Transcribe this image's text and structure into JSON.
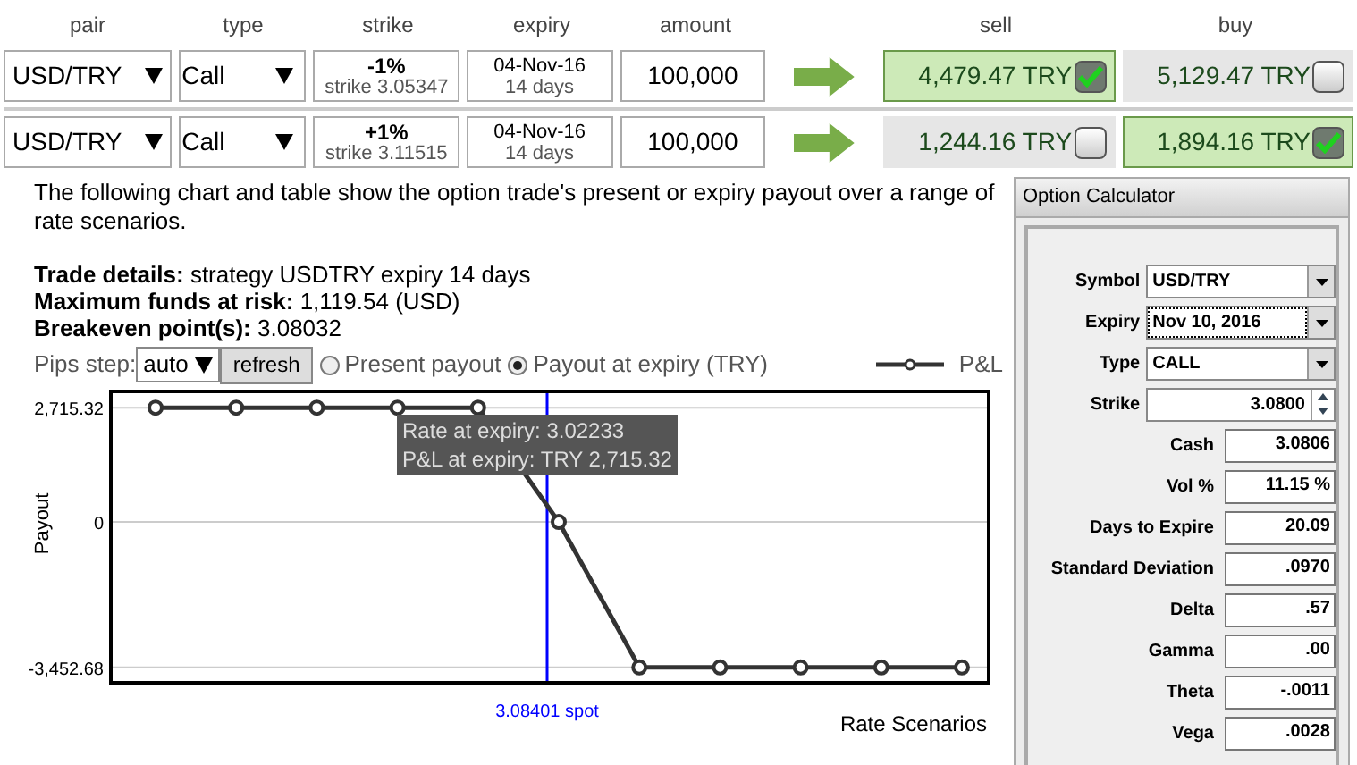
{
  "trades": {
    "columns": [
      "pair",
      "type",
      "strike",
      "expiry",
      "amount",
      "sell",
      "buy"
    ],
    "rows": [
      {
        "pair": "USD/TRY",
        "type": "Call",
        "strike_pct": "-1%",
        "strike": "strike 3.05347",
        "expiry_date": "04-Nov-16",
        "expiry_days": "14 days",
        "amount": "100,000",
        "sell": {
          "value": "4,479.47 TRY",
          "selected": true
        },
        "buy": {
          "value": "5,129.47 TRY",
          "selected": false
        }
      },
      {
        "pair": "USD/TRY",
        "type": "Call",
        "strike_pct": "+1%",
        "strike": "strike 3.11515",
        "expiry_date": "04-Nov-16",
        "expiry_days": "14 days",
        "amount": "100,000",
        "sell": {
          "value": "1,244.16 TRY",
          "selected": false
        },
        "buy": {
          "value": "1,894.16 TRY",
          "selected": true
        }
      }
    ]
  },
  "description": "The following chart and table show the option trade's present or expiry payout over a range of rate scenarios.",
  "details": [
    {
      "label": "Trade details:",
      "value": "strategy USDTRY expiry 14 days"
    },
    {
      "label": "Maximum funds at risk:",
      "value": "1,119.54 (USD)"
    },
    {
      "label": "Breakeven point(s):",
      "value": "3.08032"
    }
  ],
  "pips": {
    "label": "Pips step:",
    "value": "auto",
    "button": "refresh"
  },
  "payout_options": [
    {
      "label": "Present payout",
      "selected": false
    },
    {
      "label": "Payout at expiry (TRY)",
      "selected": true
    }
  ],
  "chart": {
    "chart_data": {
      "type": "line",
      "xlabel": "Rate Scenarios",
      "ylabel": "Payout",
      "series": [
        {
          "name": "P&L",
          "color": "#333333",
          "values": [
            2715.32,
            2715.32,
            2715.32,
            2715.32,
            2715.32,
            0,
            -3452.68,
            -3452.68,
            -3452.68,
            -3452.68,
            -3452.68
          ]
        }
      ],
      "ylim": [
        -3860,
        3100
      ],
      "grid": true,
      "marker": "circle",
      "yticks": [
        {
          "value": 2715.32,
          "label": "2,715.32"
        },
        {
          "value": 0,
          "label": "0"
        },
        {
          "value": -3452.68,
          "label": "-3,452.68"
        }
      ],
      "annotations": [
        "3.08401 spot"
      ]
    },
    "tooltip": [
      "Rate at expiry: 3.02233",
      "P&L at expiry: TRY 2,715.32"
    ]
  },
  "calculator": {
    "title": "Option Calculator",
    "fields": [
      {
        "label": "Symbol",
        "value": "USD/TRY",
        "kind": "select",
        "focused": false
      },
      {
        "label": "Expiry",
        "value": "Nov 10, 2016",
        "kind": "select",
        "focused": true
      },
      {
        "label": "Type",
        "value": "CALL",
        "kind": "select",
        "focused": false
      },
      {
        "label": "Strike",
        "value": "3.0800",
        "kind": "spinner",
        "focused": false
      },
      {
        "label": "Cash",
        "value": "3.0806",
        "kind": "output"
      },
      {
        "label": "Vol %",
        "value": "11.15 %",
        "kind": "output"
      },
      {
        "label": "Days to Expire",
        "value": "20.09",
        "kind": "output"
      },
      {
        "label": "Standard Deviation",
        "value": ".0970",
        "kind": "output"
      },
      {
        "label": "Delta",
        "value": ".57",
        "kind": "output"
      },
      {
        "label": "Gamma",
        "value": ".00",
        "kind": "output"
      },
      {
        "label": "Theta",
        "value": "-.0011",
        "kind": "output"
      },
      {
        "label": "Vega",
        "value": ".0028",
        "kind": "output"
      }
    ]
  }
}
